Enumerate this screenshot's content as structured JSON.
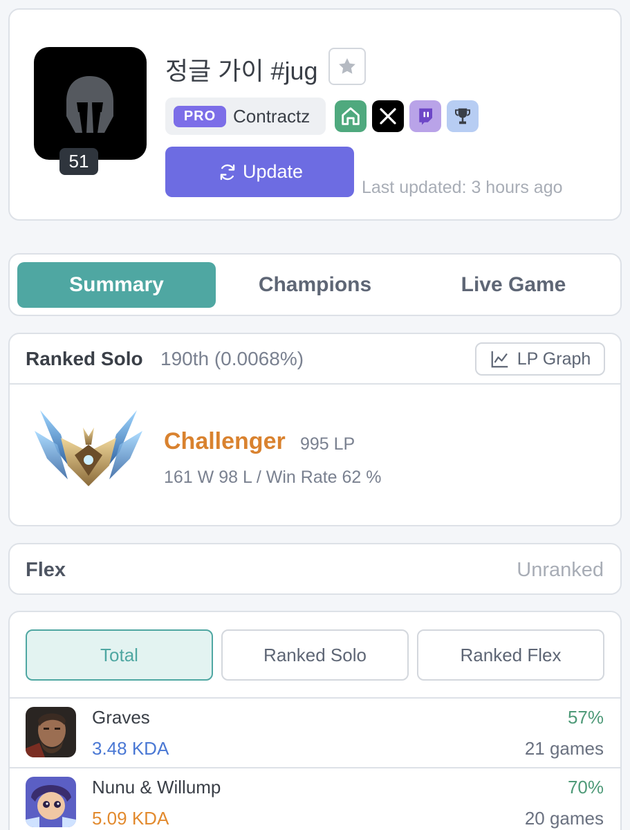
{
  "profile": {
    "level": "51",
    "name": "정글 가이",
    "tag": "#jug",
    "pro_badge": "PRO",
    "pro_name": "Contractz",
    "update_label": "Update",
    "last_updated": "Last updated: 3 hours ago",
    "socials": [
      "home-icon",
      "x-icon",
      "twitch-icon",
      "trophy-icon"
    ]
  },
  "tabs": [
    {
      "label": "Summary",
      "active": true
    },
    {
      "label": "Champions",
      "active": false
    },
    {
      "label": "Live Game",
      "active": false
    }
  ],
  "ranked_solo": {
    "title": "Ranked Solo",
    "rank": "190th (0.0068%)",
    "lp_graph_label": "LP Graph",
    "tier": "Challenger",
    "lp": "995 LP",
    "record": "161 W 98 L / Win Rate 62 %"
  },
  "flex": {
    "title": "Flex",
    "status": "Unranked"
  },
  "champion_filters": [
    {
      "label": "Total",
      "active": true
    },
    {
      "label": "Ranked Solo",
      "active": false
    },
    {
      "label": "Ranked Flex",
      "active": false
    }
  ],
  "champions": [
    {
      "name": "Graves",
      "kda": "3.48 KDA",
      "kda_color": "#4a78d4",
      "winrate": "57%",
      "games": "21 games"
    },
    {
      "name": "Nunu & Willump",
      "kda": "5.09 KDA",
      "kda_color": "#e28a2e",
      "winrate": "70%",
      "games": "20 games"
    }
  ],
  "colors": {
    "accent_teal": "#4fa7a2",
    "update_purple": "#6d6ce2",
    "challenger_orange": "#d9822f",
    "winrate_green": "#4e9a78"
  }
}
